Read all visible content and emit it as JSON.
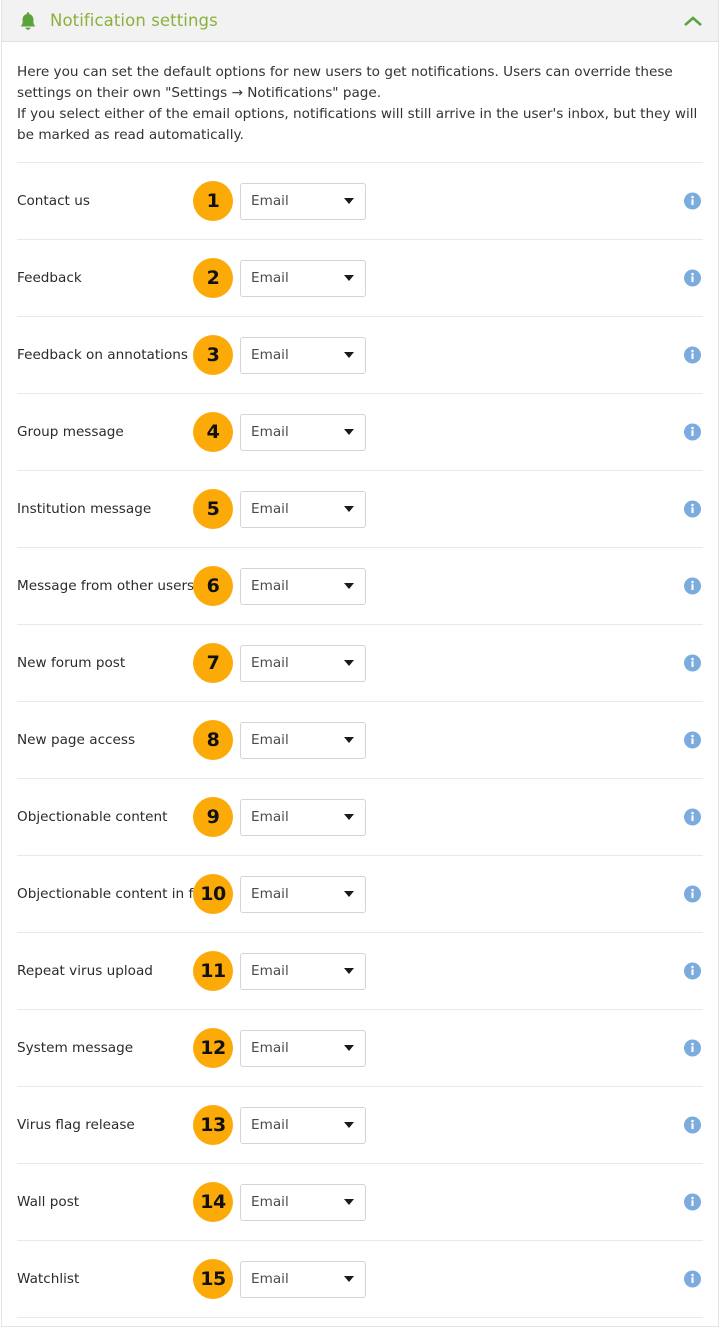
{
  "header": {
    "icon": "bell-icon",
    "title": "Notification settings",
    "collapse_icon": "chevron-up-icon",
    "accent_color": "#8cb03c",
    "background": "#f2f2f2"
  },
  "intro": {
    "line1": "Here you can set the default options for new users to get notifications. Users can override these settings on their own \"Settings → Notifications\" page.",
    "line2": "If you select either of the email options, notifications will still arrive in the user's inbox, but they will be marked as read automatically."
  },
  "badge_color": "#fcaa08",
  "info_color": "#7bacdd",
  "select_value": "Email",
  "info_icon_name": "info-circle-icon",
  "rows": [
    {
      "n": "1",
      "label": "Contact us",
      "value": "Email"
    },
    {
      "n": "2",
      "label": "Feedback",
      "value": "Email"
    },
    {
      "n": "3",
      "label": "Feedback on annotations",
      "value": "Email"
    },
    {
      "n": "4",
      "label": "Group message",
      "value": "Email"
    },
    {
      "n": "5",
      "label": "Institution message",
      "value": "Email"
    },
    {
      "n": "6",
      "label": "Message from other users",
      "value": "Email"
    },
    {
      "n": "7",
      "label": "New forum post",
      "value": "Email"
    },
    {
      "n": "8",
      "label": "New page access",
      "value": "Email"
    },
    {
      "n": "9",
      "label": "Objectionable content",
      "value": "Email"
    },
    {
      "n": "10",
      "label": "Objectionable content in forum",
      "value": "Email"
    },
    {
      "n": "11",
      "label": "Repeat virus upload",
      "value": "Email"
    },
    {
      "n": "12",
      "label": "System message",
      "value": "Email"
    },
    {
      "n": "13",
      "label": "Virus flag release",
      "value": "Email"
    },
    {
      "n": "14",
      "label": "Wall post",
      "value": "Email"
    },
    {
      "n": "15",
      "label": "Watchlist",
      "value": "Email"
    }
  ]
}
